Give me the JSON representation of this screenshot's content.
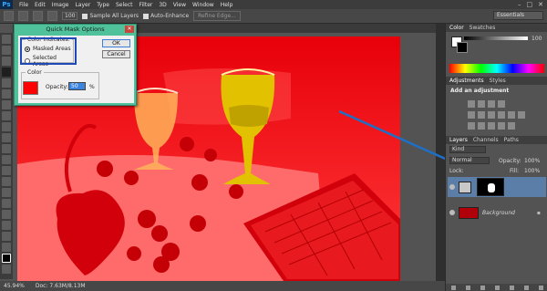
{
  "app": {
    "logo": "Ps"
  },
  "menu": [
    "File",
    "Edit",
    "Image",
    "Layer",
    "Type",
    "Select",
    "Filter",
    "3D",
    "View",
    "Window",
    "Help"
  ],
  "window_controls": [
    "–",
    "□",
    "✕"
  ],
  "options": {
    "size_value": "100",
    "sample_all_layers": "Sample All Layers",
    "auto_enhance": "Auto-Enhance",
    "refine_edge": "Refine Edge...",
    "workspace": "Essentials"
  },
  "status": {
    "zoom": "45.94%",
    "doc": "Doc: 7.63M/8.13M"
  },
  "color_panel": {
    "tabs": [
      "Color",
      "Swatches"
    ],
    "value": "100"
  },
  "adjustments_panel": {
    "tabs": [
      "Adjustments",
      "Styles"
    ],
    "heading": "Add an adjustment"
  },
  "layers_panel": {
    "tabs": [
      "Layers",
      "Channels",
      "Paths"
    ],
    "kind": "Kind",
    "blend_mode": "Normal",
    "opacity_label": "Opacity:",
    "opacity_value": "100%",
    "lock_label": "Lock:",
    "fill_label": "Fill:",
    "fill_value": "100%",
    "layers": [
      {
        "name": ""
      },
      {
        "name": "Background"
      }
    ]
  },
  "dialog": {
    "title": "Quick Mask Options",
    "color_indicates": "Color Indicates:",
    "masked": "Masked Areas",
    "selected": "Selected Areas",
    "color_group": "Color",
    "opacity_label": "Opacity:",
    "opacity_value": "50",
    "pct": "%",
    "ok": "OK",
    "cancel": "Cancel",
    "mask_color": "#ff0000"
  },
  "colors": {
    "accent_annotation": "#1f6fc6",
    "dialog_frame": "#4fc29b"
  }
}
